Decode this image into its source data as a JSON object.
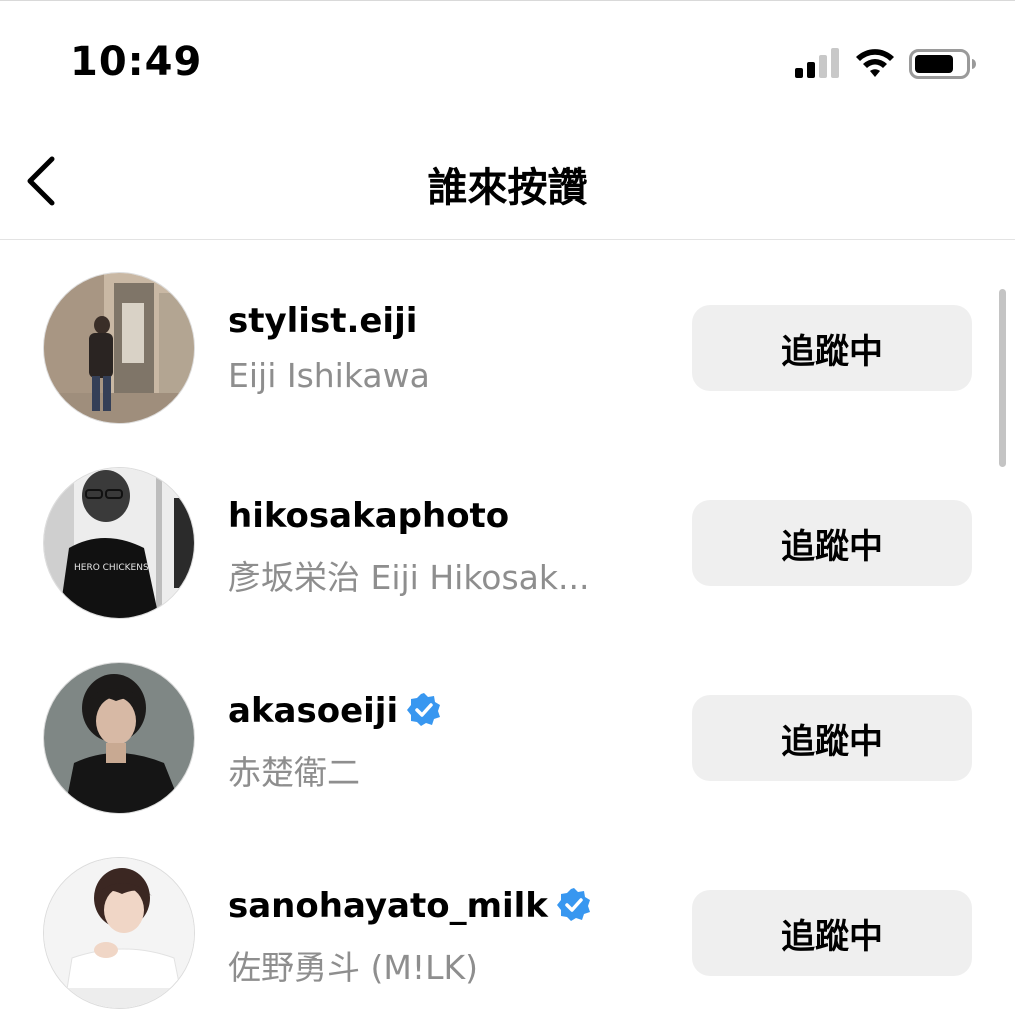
{
  "status_bar": {
    "time": "10:49"
  },
  "nav": {
    "title": "誰來按讚",
    "back_icon": "chevron-left-icon"
  },
  "likers": [
    {
      "username": "stylist.eiji",
      "full_name": "Eiji Ishikawa",
      "verified": false,
      "button_label": "追蹤中"
    },
    {
      "username": "hikosakaphoto",
      "full_name": "彥坂栄治 Eiji Hikosak...",
      "verified": false,
      "button_label": "追蹤中"
    },
    {
      "username": "akasoeiji",
      "full_name": "赤楚衛二",
      "verified": true,
      "button_label": "追蹤中"
    },
    {
      "username": "sanohayato_milk",
      "full_name": "佐野勇斗 (M!LK)",
      "verified": true,
      "button_label": "追蹤中"
    }
  ],
  "colors": {
    "verified_badge": "#3897f0",
    "button_bg": "#efefef",
    "secondary_text": "#8e8e8e"
  }
}
